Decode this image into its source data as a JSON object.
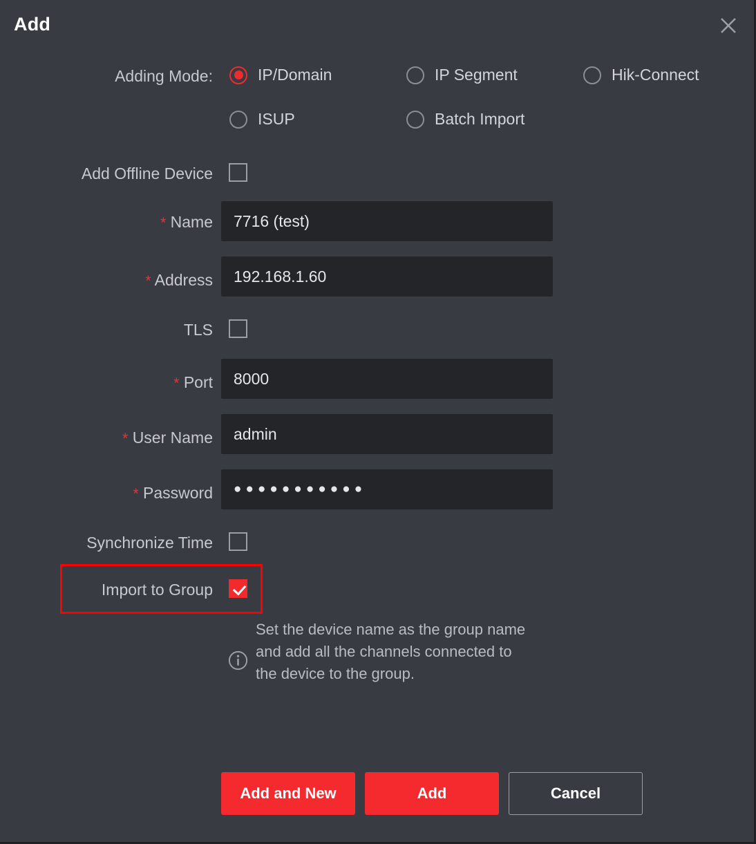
{
  "dialog": {
    "title": "Add",
    "close_icon": "close-icon"
  },
  "adding_mode": {
    "label": "Adding Mode:",
    "options": [
      {
        "label": "IP/Domain",
        "selected": true
      },
      {
        "label": "IP Segment",
        "selected": false
      },
      {
        "label": "Hik-Connect",
        "selected": false
      },
      {
        "label": "ISUP",
        "selected": false
      },
      {
        "label": "Batch Import",
        "selected": false
      }
    ]
  },
  "form": {
    "add_offline_device": {
      "label": "Add Offline Device",
      "checked": false
    },
    "name": {
      "label": "Name",
      "required_mark": "*",
      "value": "7716 (test)",
      "placeholder": ""
    },
    "address": {
      "label": "Address",
      "required_mark": "*",
      "value": "192.168.1.60",
      "placeholder": ""
    },
    "tls": {
      "label": "TLS",
      "checked": false
    },
    "port": {
      "label": "Port",
      "required_mark": "*",
      "value": "8000",
      "placeholder": ""
    },
    "user_name": {
      "label": "User Name",
      "required_mark": "*",
      "value": "admin",
      "placeholder": ""
    },
    "password": {
      "label": "Password",
      "required_mark": "*",
      "value": "●●●●●●●●●●●",
      "placeholder": ""
    },
    "synchronize_time": {
      "label": "Synchronize Time",
      "checked": false
    },
    "import_to_group": {
      "label": "Import to Group",
      "checked": true,
      "highlighted": true
    }
  },
  "hint": {
    "icon": "info-icon",
    "text": "Set the device name as the group name and add all the channels connected to the device to the group."
  },
  "footer": {
    "add_and_new_label": "Add and New",
    "add_label": "Add",
    "cancel_label": "Cancel"
  },
  "colors": {
    "dialog_bg": "#383b41",
    "input_bg": "#242529",
    "accent_red": "#f52a2e",
    "required_red": "#f03030",
    "highlight_red": "#ff0000",
    "label_text": "#c6c9ce",
    "value_text": "#e3e6ea"
  }
}
